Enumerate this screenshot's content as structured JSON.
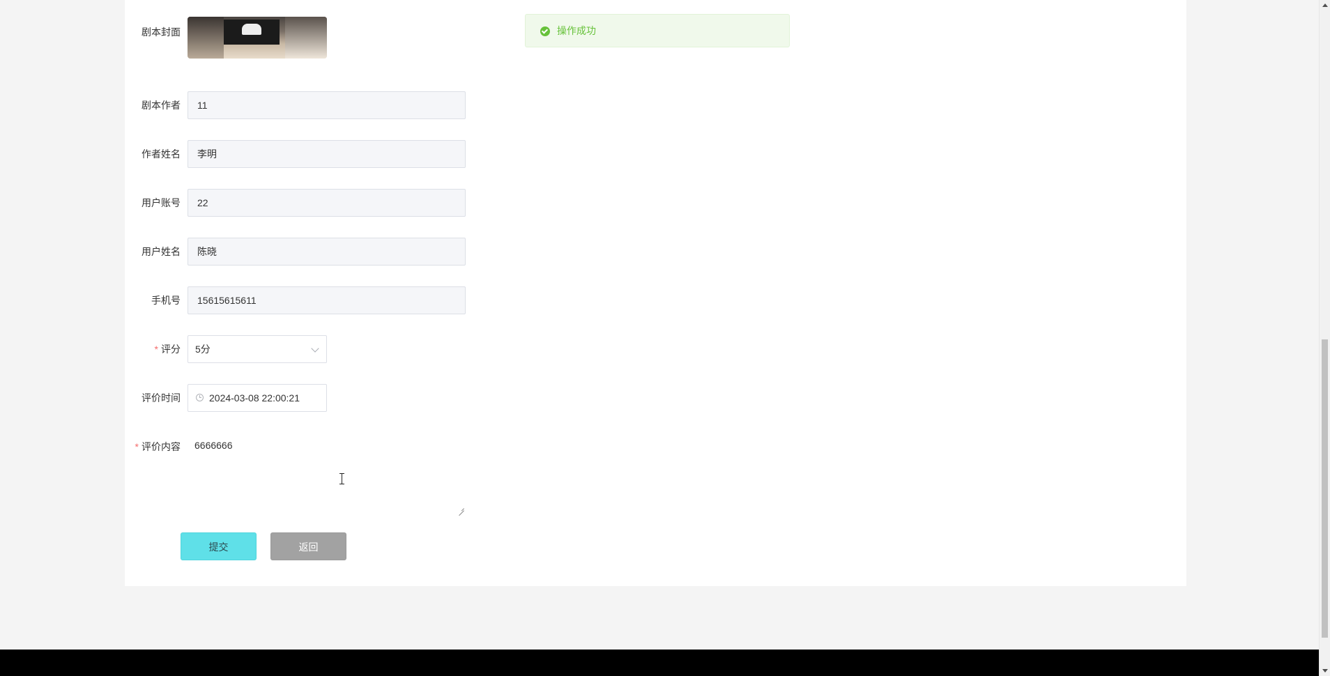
{
  "form": {
    "cover_label": "剧本封面",
    "author_label": "剧本作者",
    "author_value": "11",
    "author_name_label": "作者姓名",
    "author_name_value": "李明",
    "user_account_label": "用户账号",
    "user_account_value": "22",
    "user_name_label": "用户姓名",
    "user_name_value": "陈晓",
    "phone_label": "手机号",
    "phone_value": "15615615611",
    "rating_label": "评分",
    "rating_value": "5分",
    "review_time_label": "评价时间",
    "review_time_value": "2024-03-08 22:00:21",
    "review_content_label": "评价内容",
    "review_content_value": "6666666",
    "required_mark": "*"
  },
  "buttons": {
    "submit": "提交",
    "back": "返回"
  },
  "toast": {
    "message": "操作成功",
    "color": "#67c23a"
  },
  "colors": {
    "submit_bg": "#5fe0e8",
    "back_bg": "#a2a2a2",
    "required": "#f56c6c"
  }
}
